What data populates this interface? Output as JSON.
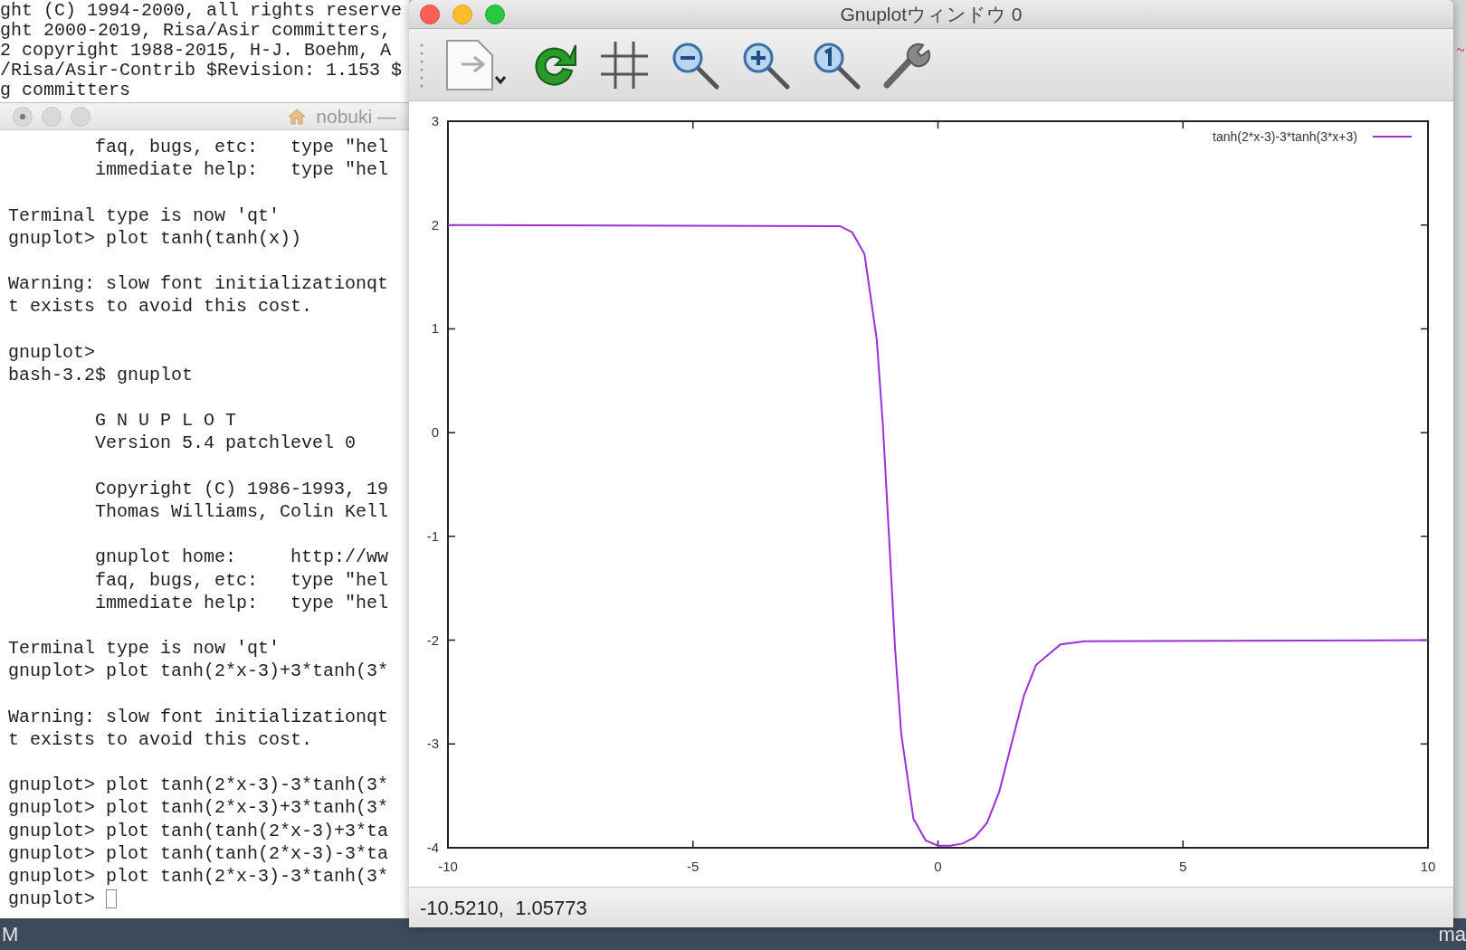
{
  "background_terminal": {
    "lines": [
      "ght (C) 1994-2000, all rights reserve",
      "ght 2000-2019, Risa/Asir committers,",
      "2 copyright 1988-2015, H-J. Boehm, A",
      "/Risa/Asir-Contrib $Revision: 1.153 $",
      "g committers"
    ]
  },
  "terminal": {
    "title": "nobuki —",
    "blocks": [
      [
        "        faq, bugs, etc:   type \"hel",
        "        immediate help:   type \"hel"
      ],
      [
        "Terminal type is now 'qt'",
        "gnuplot> plot tanh(tanh(x))"
      ],
      [
        "Warning: slow font initializationqt",
        "t exists to avoid this cost."
      ],
      [
        "gnuplot>",
        "bash-3.2$ gnuplot"
      ],
      [
        "        G N U P L O T",
        "        Version 5.4 patchlevel 0"
      ],
      [
        "        Copyright (C) 1986-1993, 19",
        "        Thomas Williams, Colin Kell"
      ],
      [
        "        gnuplot home:     http://ww",
        "        faq, bugs, etc:   type \"hel",
        "        immediate help:   type \"hel"
      ],
      [
        "Terminal type is now 'qt'",
        "gnuplot> plot tanh(2*x-3)+3*tanh(3*"
      ],
      [
        "Warning: slow font initializationqt",
        "t exists to avoid this cost."
      ],
      [
        "gnuplot> plot tanh(2*x-3)-3*tanh(3*",
        "gnuplot> plot tanh(2*x-3)+3*tanh(3*",
        "gnuplot> plot tanh(tanh(2*x-3)+3*ta",
        "gnuplot> plot tanh(tanh(2*x-3)-3*ta",
        "gnuplot> plot tanh(2*x-3)-3*tanh(3*",
        "gnuplot> "
      ]
    ]
  },
  "gnuplot_window": {
    "title": "Gnuplotウィンドウ 0",
    "chart_data": {
      "type": "line",
      "x": [
        -10,
        -2,
        -1.75,
        -1.5,
        -1.25,
        -1.125,
        -1,
        -0.875,
        -0.75,
        -0.5,
        -0.25,
        0,
        0.25,
        0.5,
        0.75,
        1,
        1.25,
        1.5,
        1.75,
        2,
        2.5,
        3,
        10
      ],
      "series": [
        {
          "name": "tanh(2*x-3)-3*tanh(3*x+3)",
          "color": "#9b30d9",
          "values": [
            2,
            1.99,
            1.93,
            1.72,
            0.9,
            0.08,
            -1,
            -2.08,
            -2.9,
            -3.72,
            -3.93,
            -3.98,
            -3.98,
            -3.96,
            -3.9,
            -3.76,
            -3.46,
            -3,
            -2.54,
            -2.24,
            -2.04,
            -2.01,
            -2
          ]
        }
      ],
      "xlim": [
        -10,
        10
      ],
      "ylim": [
        -4,
        3
      ],
      "xticks": [
        -10,
        -5,
        0,
        5,
        10
      ],
      "yticks": [
        -4,
        -3,
        -2,
        -1,
        0,
        1,
        2,
        3
      ]
    },
    "status": "-10.5210,  1.05773"
  },
  "desktop": {
    "left_text": "M",
    "right_text": "ma"
  }
}
